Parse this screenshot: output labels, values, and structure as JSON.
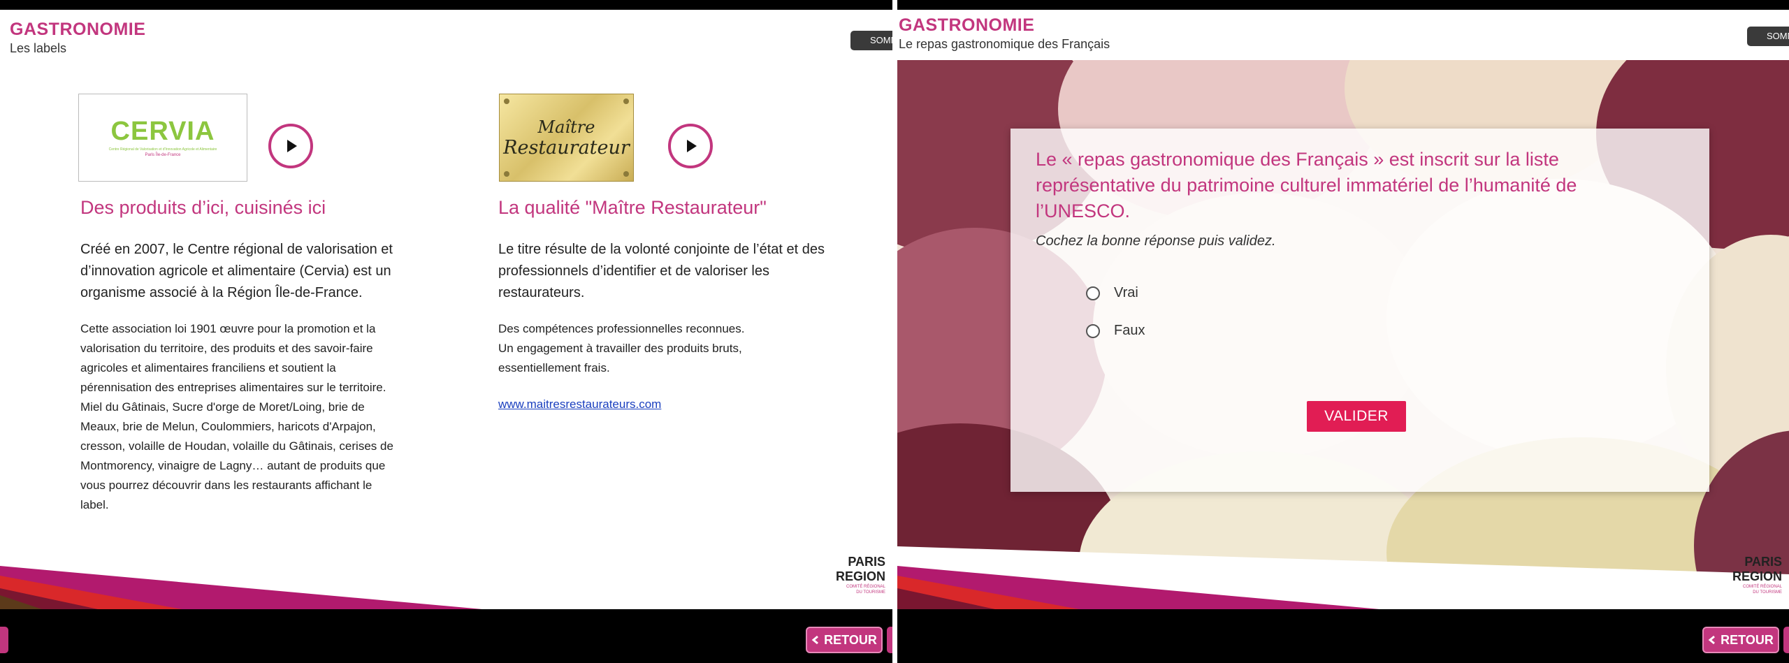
{
  "left_slide": {
    "header": {
      "title": "GASTRONOMIE",
      "subtitle": "Les labels"
    },
    "sommaire_label": "SOMMAIRE",
    "cervia_logo": {
      "word": "CERVIA",
      "tagline": "Centre Régional de Valorisation et d'Innovation Agricole et Alimentaire",
      "region": "Paris Île-de-France"
    },
    "maitre_logo": {
      "line1": "Maître",
      "line2": "Restaurateur"
    },
    "col1": {
      "title": "Des produits d’ici, cuisinés ici",
      "lead": [
        "Créé en 2007, le Centre régional de valorisation et",
        "d’innovation agricole et alimentaire (Cervia) est un",
        "organisme associé à la Région Île-de-France."
      ],
      "body": [
        "Cette association loi 1901 œuvre pour la promotion et la",
        "valorisation du territoire, des produits et des savoir-faire",
        "agricoles et alimentaires franciliens et soutient la",
        "pérennisation des entreprises alimentaires sur le territoire.",
        "Miel du Gâtinais, Sucre d'orge de Moret/Loing, brie de",
        "Meaux, brie de Melun, Coulommiers, haricots d'Arpajon,",
        "cresson, volaille de Houdan, volaille du Gâtinais, cerises de",
        "Montmorency, vinaigre de Lagny… autant de produits que",
        "vous pourrez découvrir dans les restaurants affichant le",
        "label."
      ]
    },
    "col2": {
      "title": "La qualité \"Maître Restaurateur\"",
      "lead": [
        "Le titre résulte de la volonté conjointe de l’état et des",
        "professionnels d’identifier et de valoriser les",
        "restaurateurs."
      ],
      "body": [
        "Des compétences professionnelles reconnues.",
        "Un engagement à travailler des produits bruts,",
        "essentiellement frais."
      ],
      "link": "www.maitresrestaurateurs.com"
    },
    "brand": {
      "line1": "PARIS",
      "line2": "REGION",
      "small1": "COMITÉ RÉGIONAL",
      "small2": "DU TOURISME"
    },
    "retour_label": "RETOUR"
  },
  "right_slide": {
    "header": {
      "title": "GASTRONOMIE",
      "subtitle": "Le repas gastronomique des Français"
    },
    "sommaire_label": "SOMMAIRE",
    "quiz": {
      "question": [
        "Le « repas gastronomique des Français »  est inscrit sur la liste",
        "représentative du patrimoine culturel immatériel de l’humanité de",
        "l’UNESCO."
      ],
      "hint": "Cochez la bonne réponse puis validez.",
      "options": [
        "Vrai",
        "Faux"
      ],
      "submit_label": "VALIDER"
    },
    "brand": {
      "line1": "PARIS",
      "line2": "REGION",
      "small1": "COMITÉ RÉGIONAL",
      "small2": "DU TOURISME"
    },
    "retour_label": "RETOUR"
  },
  "colors": {
    "accent": "#c2367e",
    "valider": "#e11d54",
    "cervia_green": "#8cc63f"
  }
}
